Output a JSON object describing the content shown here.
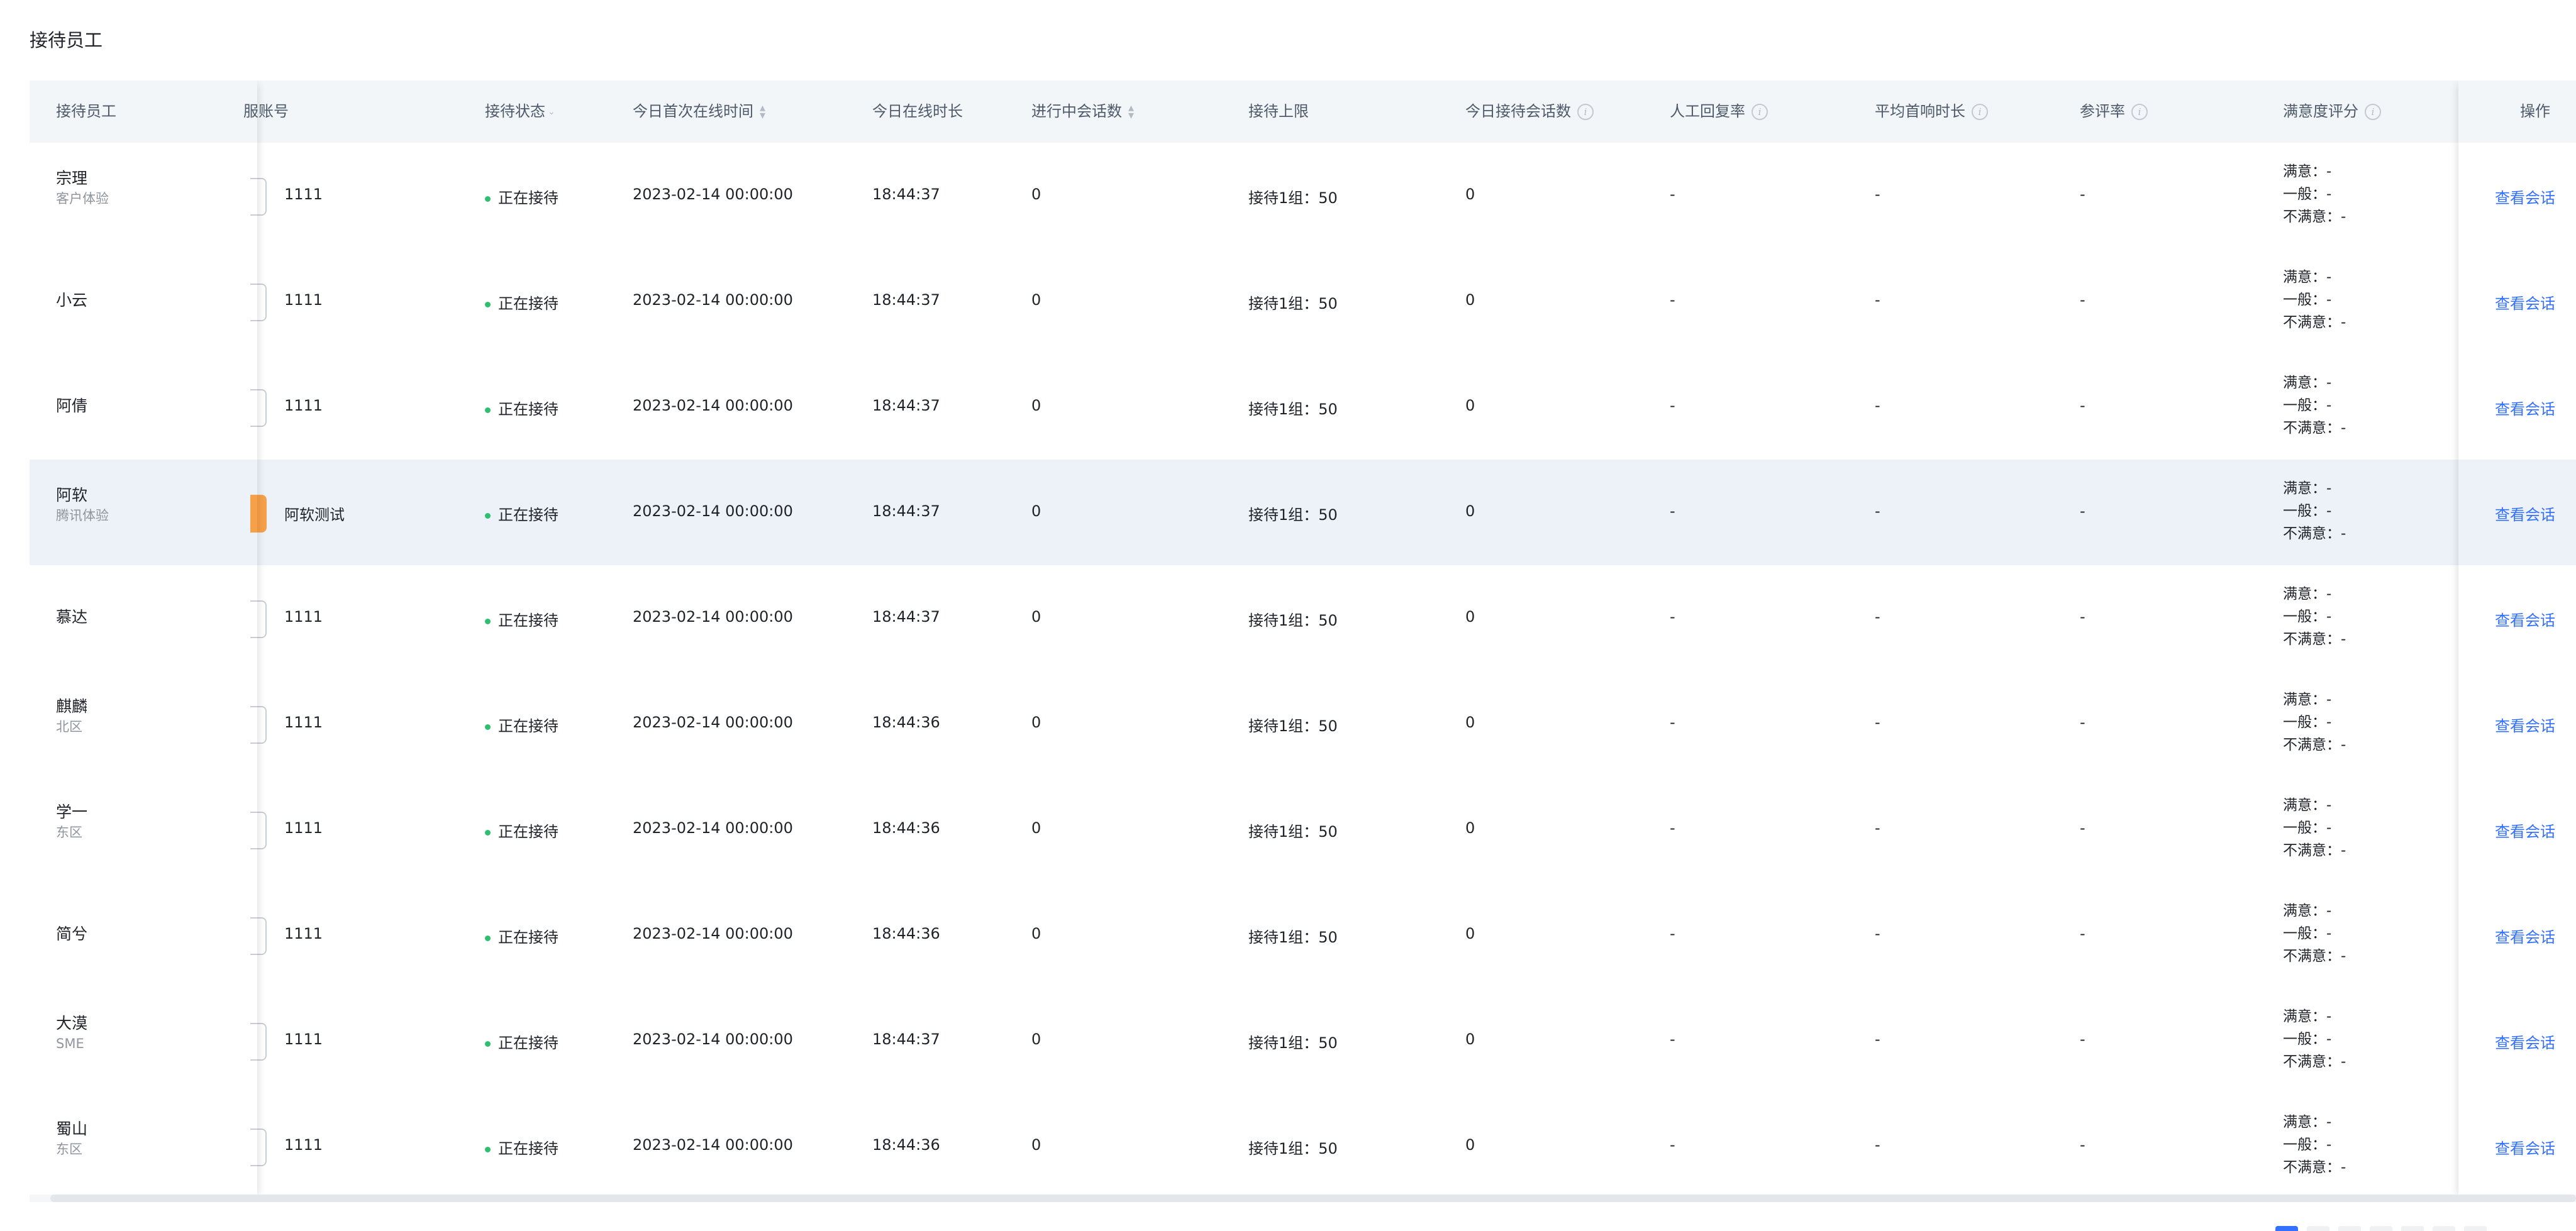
{
  "page": {
    "title": "接待员工"
  },
  "columns": {
    "staff": "接待员工",
    "account": "服账号",
    "status": "接待状态",
    "first_online": "今日首次在线时间",
    "online_duration": "今日在线时长",
    "ongoing": "进行中会话数",
    "limit": "接待上限",
    "today_sessions": "今日接待会话数",
    "reply_rate": "人工回复率",
    "avg_response": "平均首响时长",
    "review_rate": "参评率",
    "satisfaction": "满意度评分",
    "actions": "操作"
  },
  "rows": [
    {
      "name": "宗理",
      "dept": "客户体验",
      "account": "1111",
      "status": "正在接待",
      "first_online": "2023-02-14 00:00:00",
      "duration": "18:44:37",
      "ongoing": "0",
      "limit": "接待1组：50",
      "today": "0",
      "reply_rate": "-",
      "avg_response": "-",
      "review_rate": "-",
      "sat": {
        "good": "满意：-",
        "normal": "一般：-",
        "bad": "不满意：-"
      },
      "action": "查看会话"
    },
    {
      "name": "小云",
      "dept": "",
      "account": "1111",
      "status": "正在接待",
      "first_online": "2023-02-14 00:00:00",
      "duration": "18:44:37",
      "ongoing": "0",
      "limit": "接待1组：50",
      "today": "0",
      "reply_rate": "-",
      "avg_response": "-",
      "review_rate": "-",
      "sat": {
        "good": "满意：-",
        "normal": "一般：-",
        "bad": "不满意：-"
      },
      "action": "查看会话"
    },
    {
      "name": "阿倩",
      "dept": "",
      "account": "1111",
      "status": "正在接待",
      "first_online": "2023-02-14 00:00:00",
      "duration": "18:44:37",
      "ongoing": "0",
      "limit": "接待1组：50",
      "today": "0",
      "reply_rate": "-",
      "avg_response": "-",
      "review_rate": "-",
      "sat": {
        "good": "满意：-",
        "normal": "一般：-",
        "bad": "不满意：-"
      },
      "action": "查看会话"
    },
    {
      "name": "阿软",
      "dept": "腾讯体验",
      "account": "阿软测试",
      "status": "正在接待",
      "first_online": "2023-02-14 00:00:00",
      "duration": "18:44:37",
      "ongoing": "0",
      "limit": "接待1组：50",
      "today": "0",
      "reply_rate": "-",
      "avg_response": "-",
      "review_rate": "-",
      "sat": {
        "good": "满意：-",
        "normal": "一般：-",
        "bad": "不满意：-"
      },
      "action": "查看会话"
    },
    {
      "name": "慕达",
      "dept": "",
      "account": "1111",
      "status": "正在接待",
      "first_online": "2023-02-14 00:00:00",
      "duration": "18:44:37",
      "ongoing": "0",
      "limit": "接待1组：50",
      "today": "0",
      "reply_rate": "-",
      "avg_response": "-",
      "review_rate": "-",
      "sat": {
        "good": "满意：-",
        "normal": "一般：-",
        "bad": "不满意：-"
      },
      "action": "查看会话"
    },
    {
      "name": "麒麟",
      "dept": "北区",
      "account": "1111",
      "status": "正在接待",
      "first_online": "2023-02-14 00:00:00",
      "duration": "18:44:36",
      "ongoing": "0",
      "limit": "接待1组：50",
      "today": "0",
      "reply_rate": "-",
      "avg_response": "-",
      "review_rate": "-",
      "sat": {
        "good": "满意：-",
        "normal": "一般：-",
        "bad": "不满意：-"
      },
      "action": "查看会话"
    },
    {
      "name": "学一",
      "dept": "东区",
      "account": "1111",
      "status": "正在接待",
      "first_online": "2023-02-14 00:00:00",
      "duration": "18:44:36",
      "ongoing": "0",
      "limit": "接待1组：50",
      "today": "0",
      "reply_rate": "-",
      "avg_response": "-",
      "review_rate": "-",
      "sat": {
        "good": "满意：-",
        "normal": "一般：-",
        "bad": "不满意：-"
      },
      "action": "查看会话"
    },
    {
      "name": "简兮",
      "dept": "",
      "account": "1111",
      "status": "正在接待",
      "first_online": "2023-02-14 00:00:00",
      "duration": "18:44:36",
      "ongoing": "0",
      "limit": "接待1组：50",
      "today": "0",
      "reply_rate": "-",
      "avg_response": "-",
      "review_rate": "-",
      "sat": {
        "good": "满意：-",
        "normal": "一般：-",
        "bad": "不满意：-"
      },
      "action": "查看会话"
    },
    {
      "name": "大漠",
      "dept": "SME",
      "account": "1111",
      "status": "正在接待",
      "first_online": "2023-02-14 00:00:00",
      "duration": "18:44:37",
      "ongoing": "0",
      "limit": "接待1组：50",
      "today": "0",
      "reply_rate": "-",
      "avg_response": "-",
      "review_rate": "-",
      "sat": {
        "good": "满意：-",
        "normal": "一般：-",
        "bad": "不满意：-"
      },
      "action": "查看会话"
    },
    {
      "name": "蜀山",
      "dept": "东区",
      "account": "1111",
      "status": "正在接待",
      "first_online": "2023-02-14 00:00:00",
      "duration": "18:44:36",
      "ongoing": "0",
      "limit": "接待1组：50",
      "today": "0",
      "reply_rate": "-",
      "avg_response": "-",
      "review_rate": "-",
      "sat": {
        "good": "满意：-",
        "normal": "一般：-",
        "bad": "不满意：-"
      },
      "action": "查看会话"
    }
  ],
  "colors": {
    "accent": "#3370ff",
    "status_ok": "#2fbf71",
    "highlight_row": "#edf2f9"
  },
  "icons": {
    "sort": "sort-icon",
    "info": "info-icon",
    "filter": "chevron-down-icon"
  }
}
